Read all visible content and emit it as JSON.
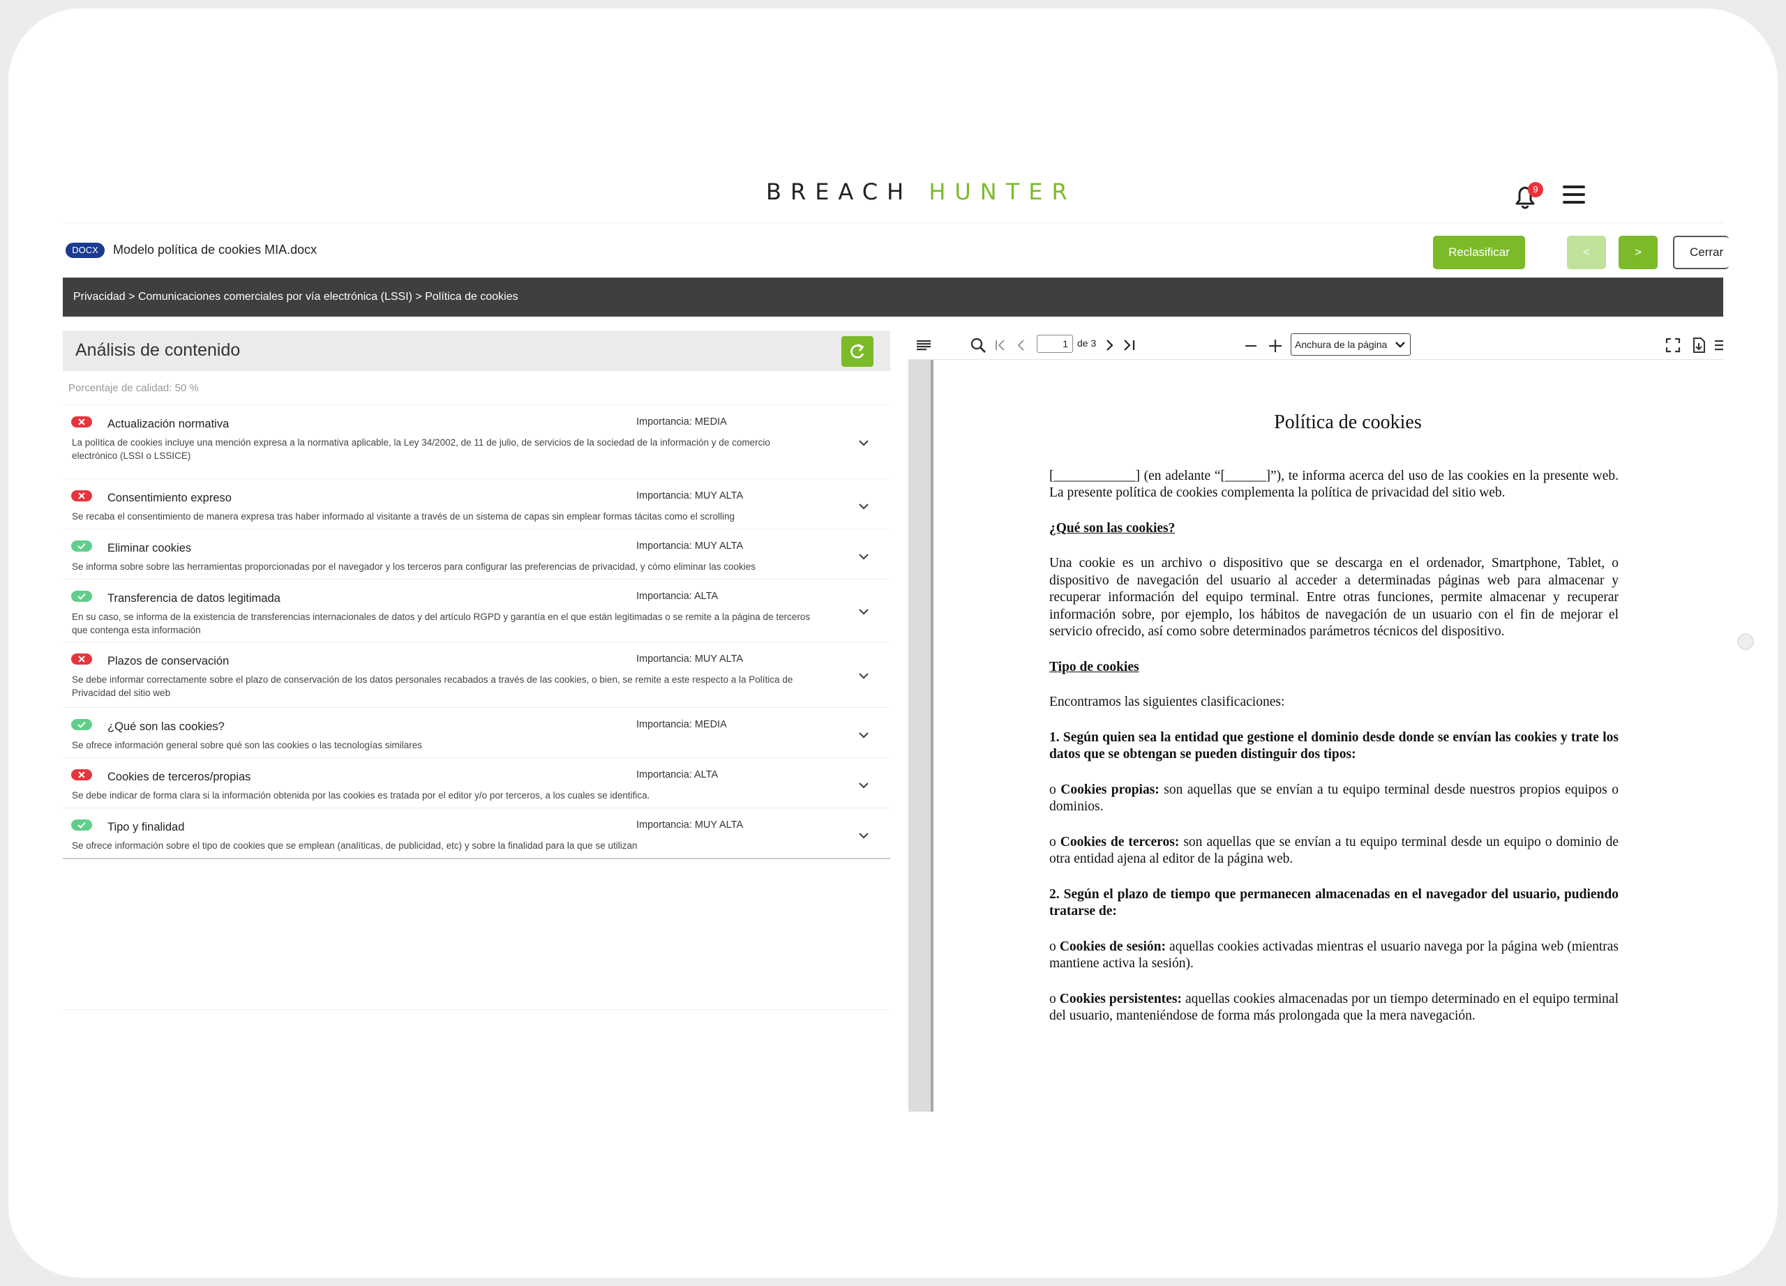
{
  "header": {
    "logo_part1": "BREACH",
    "logo_part2": "HUNTER",
    "notification_count": "9"
  },
  "file": {
    "type_badge": "DOCX",
    "name": "Modelo política de cookies MIA.docx"
  },
  "actions": {
    "reclassify": "Reclasificar",
    "prev": "<",
    "next": ">",
    "close": "Cerrar"
  },
  "breadcrumb": "Privacidad > Comunicaciones comerciales por vía electrónica (LSSI) > Política de cookies",
  "analysis": {
    "title": "Análisis de contenido",
    "quality": "Porcentaje de calidad: 50 %",
    "items": [
      {
        "name": "Actualización normativa",
        "importance": "Importancia: MEDIA",
        "ok": false,
        "desc": "La política de cookies incluye una mención expresa a la normativa aplicable, la Ley 34/2002, de 11 de julio, de servicios de la sociedad de la información y de comercio electrónico (LSSI o LSSICE)"
      },
      {
        "name": "Consentimiento expreso",
        "importance": "Importancia: MUY ALTA",
        "ok": false,
        "desc": "Se recaba el consentimiento de manera expresa tras haber informado al visitante a través de un sistema de capas sin emplear formas tácitas como el scrolling"
      },
      {
        "name": "Eliminar cookies",
        "importance": "Importancia: MUY ALTA",
        "ok": true,
        "desc": "Se informa sobre sobre las herramientas proporcionadas por el navegador y los terceros para configurar las preferencias de privacidad, y cómo eliminar las cookies"
      },
      {
        "name": "Transferencia de datos legitimada",
        "importance": "Importancia: ALTA",
        "ok": true,
        "desc": "En su caso, se informa de la existencia de transferencias internacionales de datos y del artículo RGPD y garantía en el que están legitimadas o se remite a la página de terceros que contenga esta información"
      },
      {
        "name": "Plazos de conservación",
        "importance": "Importancia: MUY ALTA",
        "ok": false,
        "desc": "Se debe informar correctamente sobre el plazo de conservación de los datos personales recabados a través de las cookies, o bien, se remite a este respecto a la Política de Privacidad del sitio web"
      },
      {
        "name": "¿Qué son las cookies?",
        "importance": "Importancia: MEDIA",
        "ok": true,
        "desc": "Se ofrece información general sobre qué son las cookies o las tecnologías similares"
      },
      {
        "name": "Cookies de terceros/propias",
        "importance": "Importancia: ALTA",
        "ok": false,
        "desc": "Se debe indicar de forma clara si la información obtenida por las cookies es tratada por el editor y/o por terceros, a los cuales se identifica."
      },
      {
        "name": "Tipo y finalidad",
        "importance": "Importancia: MUY ALTA",
        "ok": true,
        "desc": "Se ofrece información sobre el tipo de cookies que se emplean (analíticas, de publicidad, etc) y sobre la finalidad para la que se utilizan"
      }
    ]
  },
  "viewer": {
    "page": "1",
    "page_of": "de 3",
    "zoom": "Anchura de la página",
    "doc": {
      "title": "Política de cookies",
      "intro": "[____________] (en adelante “[______]”), te informa acerca del uso de las cookies en la presente web. La presente política de cookies complementa la política de privacidad del sitio web.",
      "h_what": "¿Qué son las cookies?",
      "p_what": "Una cookie es un archivo o dispositivo que se descarga en el ordenador, Smartphone, Tablet, o dispositivo de navegación del usuario al acceder a determinadas páginas web para almacenar y recuperar información del equipo terminal. Entre otras funciones, permite almacenar y recuperar información sobre, por ejemplo, los hábitos de navegación de un usuario con el fin de mejorar el servicio ofrecido, así como sobre determinados parámetros técnicos del dispositivo.",
      "h_types": "Tipo de cookies",
      "p_types": "Encontramos las siguientes clasificaciones:",
      "h_1": "1. Según quien sea la entidad que gestione el dominio desde donde se envían las cookies y trate los datos que se obtengan se pueden distinguir dos tipos:",
      "own_label": "Cookies propias:",
      "own_text": " son aquellas que se envían a tu equipo terminal desde nuestros propios equipos o dominios.",
      "third_label": "Cookies de terceros:",
      "third_text": " son aquellas que se envían a tu equipo terminal desde un equipo o dominio de otra entidad ajena al editor de la página web.",
      "h_2": "2. Según el plazo de tiempo que permanecen almacenadas en el navegador del usuario, pudiendo tratarse de:",
      "session_label": "Cookies de sesión:",
      "session_text": " aquellas cookies activadas mientras el usuario navega por la página web (mientras mantiene activa la sesión).",
      "persist_label": "Cookies persistentes:",
      "persist_text": " aquellas cookies almacenadas por un tiempo determinado en el equipo terminal del usuario, manteniéndose de forma más prolongada que la mera navegación.",
      "bullet": "o "
    }
  },
  "colors": {
    "accent": "#7cba2a",
    "error": "#e8333d",
    "success": "#5fce8a",
    "breadcrumb_bg": "#3f3f3f"
  }
}
